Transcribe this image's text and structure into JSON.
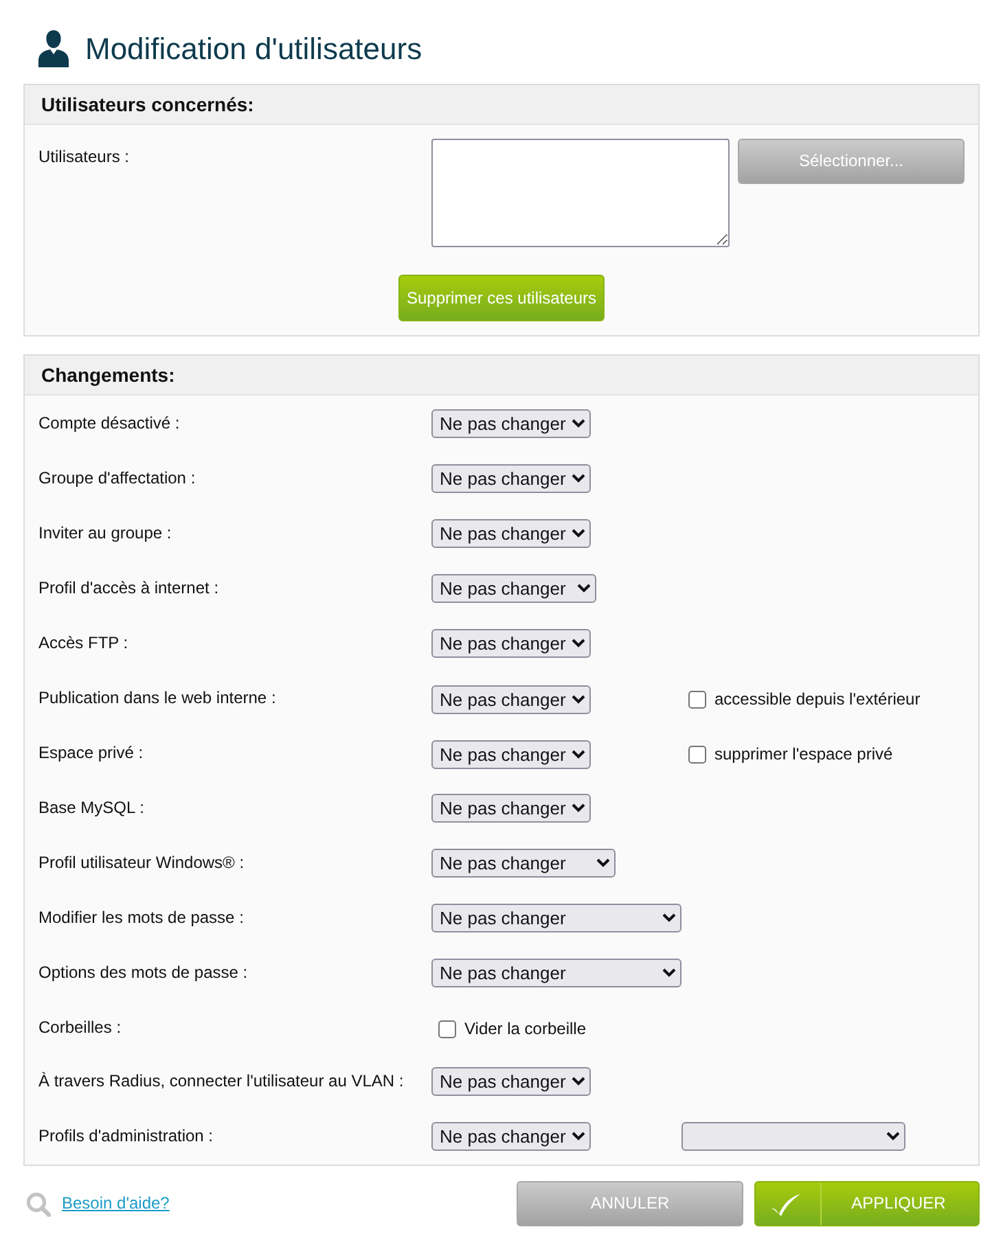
{
  "page": {
    "title": "Modification d'utilisateurs"
  },
  "users_panel": {
    "title": "Utilisateurs concernés:",
    "label": "Utilisateurs :",
    "select_button": "Sélectionner...",
    "remove_button": "Supprimer ces utilisateurs"
  },
  "changes_panel": {
    "title": "Changements:",
    "rows": [
      {
        "label": "Compte désactivé :",
        "control": {
          "kind": "select",
          "value": "Ne pas changer"
        }
      },
      {
        "label": "Groupe d'affectation :",
        "control": {
          "kind": "select",
          "value": "Ne pas changer"
        }
      },
      {
        "label": "Inviter au groupe :",
        "control": {
          "kind": "select",
          "value": "Ne pas changer"
        }
      },
      {
        "label": "Profil d'accès à internet :",
        "control": {
          "kind": "select",
          "value": "Ne pas changer"
        }
      },
      {
        "label": "Accès FTP :",
        "control": {
          "kind": "select",
          "value": "Ne pas changer"
        }
      },
      {
        "label": "Publication dans le web interne :",
        "control": {
          "kind": "select",
          "value": "Ne pas changer"
        },
        "extra": {
          "kind": "checkbox",
          "label": "accessible depuis l'extérieur",
          "checked": false
        }
      },
      {
        "label": "Espace privé :",
        "control": {
          "kind": "select",
          "value": "Ne pas changer"
        },
        "extra": {
          "kind": "checkbox",
          "label": "supprimer l'espace privé",
          "checked": false
        }
      },
      {
        "label": "Base MySQL :",
        "control": {
          "kind": "select",
          "value": "Ne pas changer"
        }
      },
      {
        "label": "Profil utilisateur Windows® :",
        "control": {
          "kind": "select",
          "value": "Ne pas changer"
        }
      },
      {
        "label": "Modifier les mots de passe :",
        "control": {
          "kind": "select",
          "value": "Ne pas changer"
        }
      },
      {
        "label": "Options des mots de passe :",
        "control": {
          "kind": "select",
          "value": "Ne pas changer"
        }
      },
      {
        "label": "Corbeilles :",
        "control": {
          "kind": "checkbox",
          "label": "Vider la corbeille",
          "checked": false
        }
      },
      {
        "label": "À travers Radius, connecter l'utilisateur au VLAN :",
        "control": {
          "kind": "select",
          "value": "Ne pas changer"
        }
      },
      {
        "label": "Profils d'administration :",
        "control": {
          "kind": "select",
          "value": "Ne pas changer"
        },
        "extra": {
          "kind": "select"
        }
      }
    ]
  },
  "footer": {
    "help_link": "Besoin d'aide?",
    "cancel_button": "ANNULER",
    "apply_button": "APPLIQUER"
  }
}
